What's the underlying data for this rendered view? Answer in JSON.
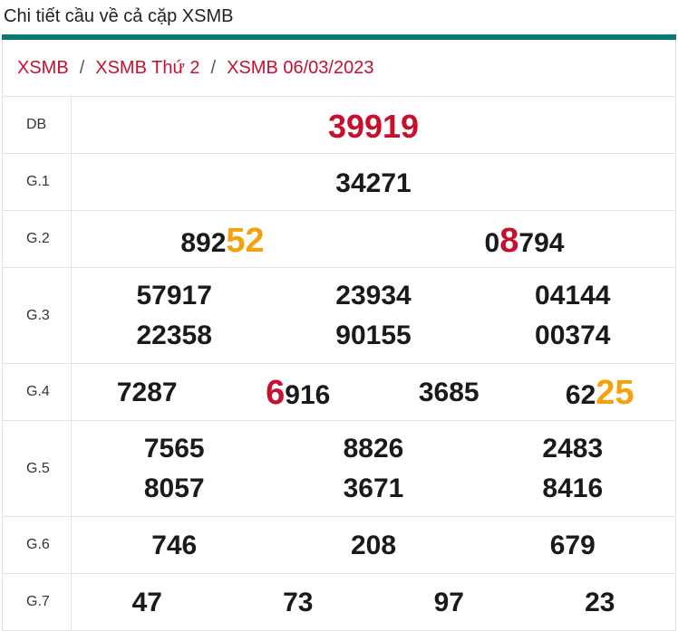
{
  "page": {
    "title": "Chi tiết cầu về cả cặp XSMB"
  },
  "breadcrumb": {
    "items": [
      "XSMB",
      "XSMB Thứ 2",
      "XSMB 06/03/2023"
    ],
    "separator": "/"
  },
  "colors": {
    "accent_bar": "#0b7a75",
    "red": "#c8102e",
    "orange": "#f5a10d"
  },
  "prizes": {
    "db": {
      "label": "DB",
      "value": "39919"
    },
    "g1": {
      "label": "G.1",
      "values": [
        "34271"
      ]
    },
    "g2": {
      "label": "G.2",
      "values": [
        {
          "prefix": "892",
          "highlight": "52",
          "suffix": "",
          "color": "orange"
        },
        {
          "prefix": "0",
          "highlight": "8",
          "suffix": "794",
          "color": "red"
        }
      ]
    },
    "g3": {
      "label": "G.3",
      "values": [
        "57917",
        "23934",
        "04144",
        "22358",
        "90155",
        "00374"
      ]
    },
    "g4": {
      "label": "G.4",
      "values": [
        {
          "prefix": "7287",
          "highlight": "",
          "suffix": "",
          "color": ""
        },
        {
          "prefix": "",
          "highlight": "6",
          "suffix": "916",
          "color": "red"
        },
        {
          "prefix": "3685",
          "highlight": "",
          "suffix": "",
          "color": ""
        },
        {
          "prefix": "62",
          "highlight": "25",
          "suffix": "",
          "color": "orange"
        }
      ]
    },
    "g5": {
      "label": "G.5",
      "values": [
        "7565",
        "8826",
        "2483",
        "8057",
        "3671",
        "8416"
      ]
    },
    "g6": {
      "label": "G.6",
      "values": [
        "746",
        "208",
        "679"
      ]
    },
    "g7": {
      "label": "G.7",
      "values": [
        "47",
        "73",
        "97",
        "23"
      ]
    }
  }
}
